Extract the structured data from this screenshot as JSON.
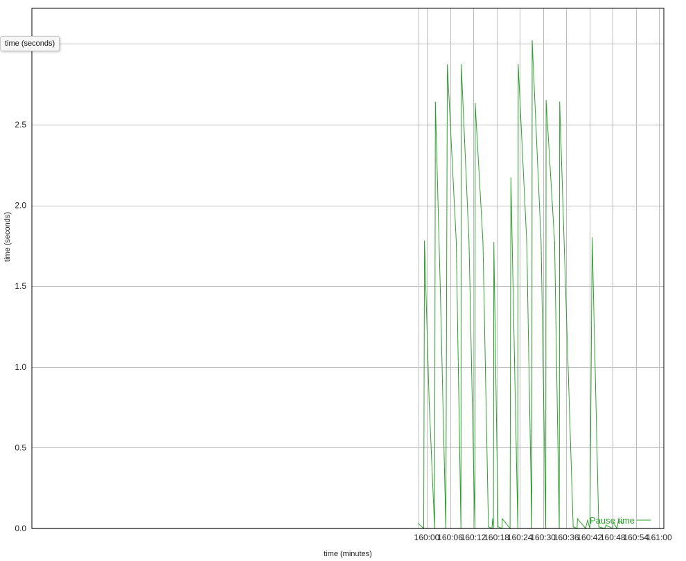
{
  "chart_data": {
    "type": "line",
    "xlabel": "time (minutes)",
    "ylabel": "time (seconds)",
    "xlim": [
      158.3,
      161.02
    ],
    "ylim": [
      0,
      3.22
    ],
    "y_ticks": [
      0.0,
      0.5,
      1.0,
      1.5,
      2.0,
      2.5
    ],
    "y_tick_labels": [
      "0.0",
      "0.5",
      "1.0",
      "1.5",
      "2.0",
      "2.5"
    ],
    "x_ticks": [
      160.0,
      160.1,
      160.2,
      160.3,
      160.4,
      160.5,
      160.6,
      160.7,
      160.8,
      160.9,
      161.0
    ],
    "x_tick_labels": [
      "160:00",
      "160:06",
      "160:12",
      "160:18",
      "160:24",
      "160:30",
      "160:36",
      "160:42",
      "160:48",
      "160:54",
      "161:00"
    ],
    "extra_grid_x": [
      159.9633
    ],
    "grid": true,
    "legend_position": "bottom-right",
    "series": [
      {
        "name": "Pause time",
        "color": "#2ca02c",
        "points": [
          [
            159.9633,
            0.03
          ],
          [
            159.9867,
            0.0
          ],
          [
            159.99,
            1.78
          ],
          [
            160.01,
            0.78
          ],
          [
            160.0333,
            0.0
          ],
          [
            160.0367,
            2.64
          ],
          [
            160.0583,
            1.47
          ],
          [
            160.0817,
            0.0
          ],
          [
            160.0883,
            2.87
          ],
          [
            160.1267,
            1.77
          ],
          [
            160.1467,
            0.0
          ],
          [
            160.1483,
            2.87
          ],
          [
            160.1817,
            1.77
          ],
          [
            160.2067,
            0.0
          ],
          [
            160.2083,
            2.63
          ],
          [
            160.2417,
            1.77
          ],
          [
            160.265,
            0.01
          ],
          [
            160.28,
            0.0
          ],
          [
            160.2833,
            0.06
          ],
          [
            160.2867,
            0.0
          ],
          [
            160.2883,
            1.77
          ],
          [
            160.3067,
            0.01
          ],
          [
            160.3233,
            0.0
          ],
          [
            160.325,
            0.06
          ],
          [
            160.3583,
            0.0
          ],
          [
            160.3617,
            2.17
          ],
          [
            160.3917,
            0.0
          ],
          [
            160.3933,
            2.87
          ],
          [
            160.43,
            1.77
          ],
          [
            160.4517,
            0.0
          ],
          [
            160.4533,
            3.02
          ],
          [
            160.4917,
            1.77
          ],
          [
            160.5117,
            0.0
          ],
          [
            160.5133,
            2.65
          ],
          [
            160.55,
            1.77
          ],
          [
            160.57,
            0.0
          ],
          [
            160.5717,
            2.64
          ],
          [
            160.63,
            0.01
          ],
          [
            160.6467,
            0.0
          ],
          [
            160.6483,
            0.06
          ],
          [
            160.6833,
            0.0
          ],
          [
            160.6917,
            0.05
          ],
          [
            160.7017,
            0.0
          ],
          [
            160.7117,
            1.8
          ],
          [
            160.74,
            0.01
          ],
          [
            160.765,
            0.0
          ],
          [
            160.7717,
            0.02
          ],
          [
            160.7983,
            0.0
          ],
          [
            160.8017,
            0.04
          ],
          [
            160.8183,
            0.0
          ],
          [
            160.825,
            0.05
          ],
          [
            160.8433,
            0.03
          ]
        ]
      }
    ],
    "tooltip_text": "time (seconds)"
  }
}
